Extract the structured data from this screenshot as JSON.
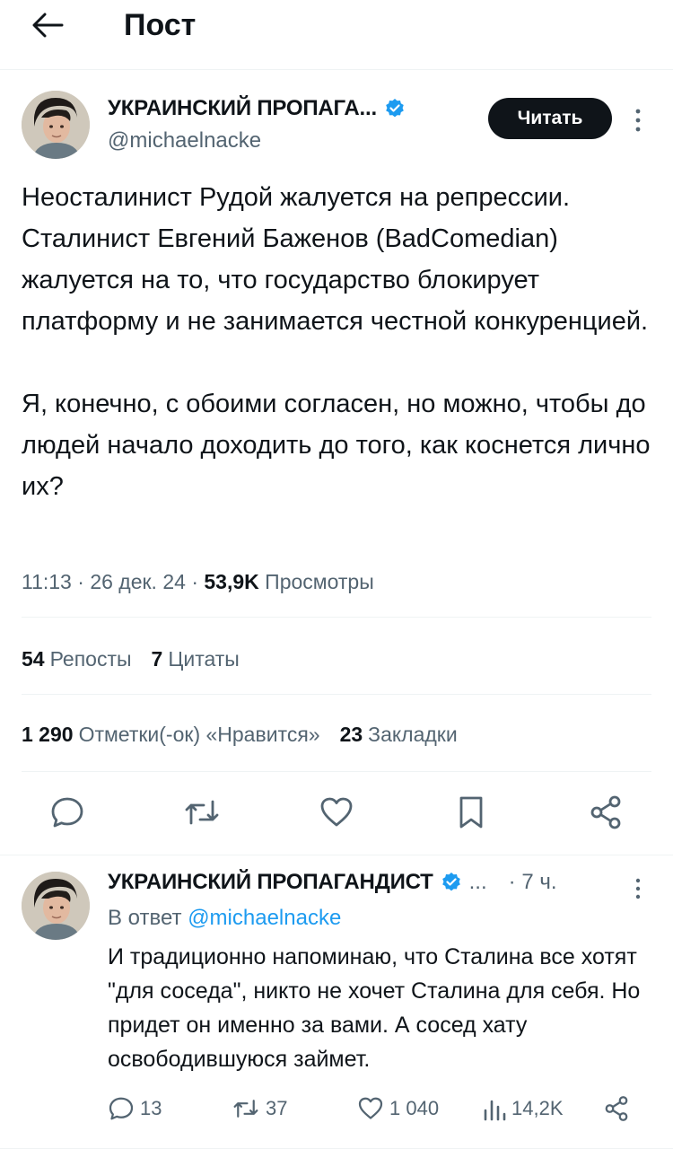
{
  "header": {
    "title": "Пост"
  },
  "tweet": {
    "author_name": "УКРАИНСКИЙ ПРОПАГА...",
    "handle": "@michaelnacke",
    "follow_label": "Читать",
    "text": "Неосталинист Рудой жалуется на репрессии. Сталинист Евгений Баженов (BadComedian) жалуется на то, что государство блокирует платформу и не занимается честной конкуренцией.\n\nЯ, конечно, с обоими согласен, но можно, чтобы до людей начало доходить до того, как коснется лично их?",
    "time": "11:13",
    "date": "26 дек. 24",
    "views": "53,9K",
    "views_label": "Просмотры",
    "reposts_count": "54",
    "reposts_label": "Репосты",
    "quotes_count": "7",
    "quotes_label": "Цитаты",
    "likes_count": "1 290",
    "likes_label": "Отметки(-ок) «Нравится»",
    "bookmarks_count": "23",
    "bookmarks_label": "Закладки"
  },
  "reply": {
    "author_name": "УКРАИНСКИЙ ПРОПАГАНДИСТ",
    "ellipsis": "...",
    "time": "· 7 ч.",
    "reply_prefix": "В ответ",
    "reply_to": "@michaelnacke",
    "text": "И традиционно напоминаю, что Сталина все хотят \"для соседа\", никто не хочет Сталина для себя. Но придет он именно за вами. А сосед хату освободившуюся займет.",
    "comments": "13",
    "reposts": "37",
    "likes": "1 040",
    "views": "14,2K"
  },
  "colors": {
    "verified": "#1d9bf0",
    "text": "#0f1419",
    "secondary": "#536471",
    "link": "#1d9bf0"
  },
  "icons": [
    "arrow-left-icon",
    "verified-badge-icon",
    "more-vertical-icon",
    "comment-icon",
    "repost-icon",
    "heart-icon",
    "bookmark-icon",
    "share-icon",
    "views-icon"
  ]
}
